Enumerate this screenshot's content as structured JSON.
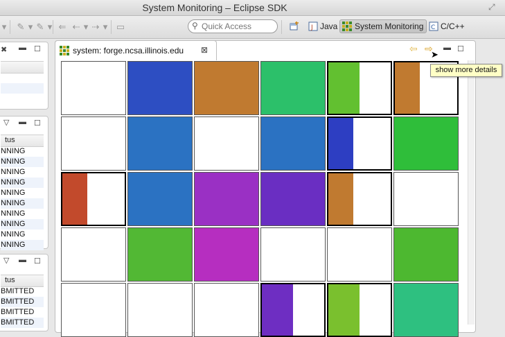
{
  "window": {
    "title": "System Monitoring – Eclipse SDK"
  },
  "toolbar": {
    "quick_access_placeholder": "Quick Access",
    "perspectives": [
      {
        "label": "",
        "icon": "open-perspective-icon"
      },
      {
        "label": "Java",
        "icon": "java-perspective-icon"
      },
      {
        "label": "System Monitoring",
        "icon": "system-monitoring-icon",
        "active": true
      },
      {
        "label": "C/C++",
        "icon": "cpp-perspective-icon"
      }
    ]
  },
  "jobs_panel": {
    "header": "tus",
    "rows": [
      "NNING",
      "NNING",
      "NNING",
      "NNING",
      "NNING",
      "NNING",
      "NNING",
      "NNING",
      "NNING",
      "NNING"
    ]
  },
  "queue_panel": {
    "header": "tus",
    "rows": [
      "BMITTED",
      "BMITTED",
      "BMITTED",
      "BMITTED"
    ]
  },
  "editor": {
    "tab_label": "system: forge.ncsa.illinois.edu",
    "tooltip": "show more details"
  },
  "colors": {
    "accent": "#2f7b2f",
    "tooltip_bg": "#ffffc6"
  },
  "node_grid": [
    [
      {
        "color": "#ffffff"
      },
      {
        "color": "#2d4ec2"
      },
      {
        "color": "#c07a30"
      },
      {
        "color": "#2cc06a"
      },
      {
        "color": "#62c030",
        "fill": 0.5
      },
      {
        "color": "#c07a30",
        "fill": 0.4
      }
    ],
    [
      {
        "color": "#ffffff"
      },
      {
        "color": "#2b72c2"
      },
      {
        "color": "#ffffff"
      },
      {
        "color": "#2b72c2"
      },
      {
        "color": "#2d3ec2",
        "fill": 0.4
      },
      {
        "color": "#2fbe3a"
      }
    ],
    [
      {
        "color": "#c24a2c",
        "fill": 0.4
      },
      {
        "color": "#2b72c2"
      },
      {
        "color": "#9a30c4"
      },
      {
        "color": "#6a2ec2"
      },
      {
        "color": "#c07a30",
        "fill": 0.4
      },
      {
        "color": "#ffffff"
      }
    ],
    [
      {
        "color": "#ffffff"
      },
      {
        "color": "#52b834"
      },
      {
        "color": "#b62ec0"
      },
      {
        "color": "#ffffff"
      },
      {
        "color": "#ffffff"
      },
      {
        "color": "#4db830"
      }
    ],
    [
      {
        "color": "#ffffff"
      },
      {
        "color": "#ffffff"
      },
      {
        "color": "#ffffff"
      },
      {
        "color": "#6e2ec2",
        "fill": 0.5
      },
      {
        "color": "#7ac02e",
        "fill": 0.5
      },
      {
        "color": "#2ec080"
      }
    ]
  ]
}
